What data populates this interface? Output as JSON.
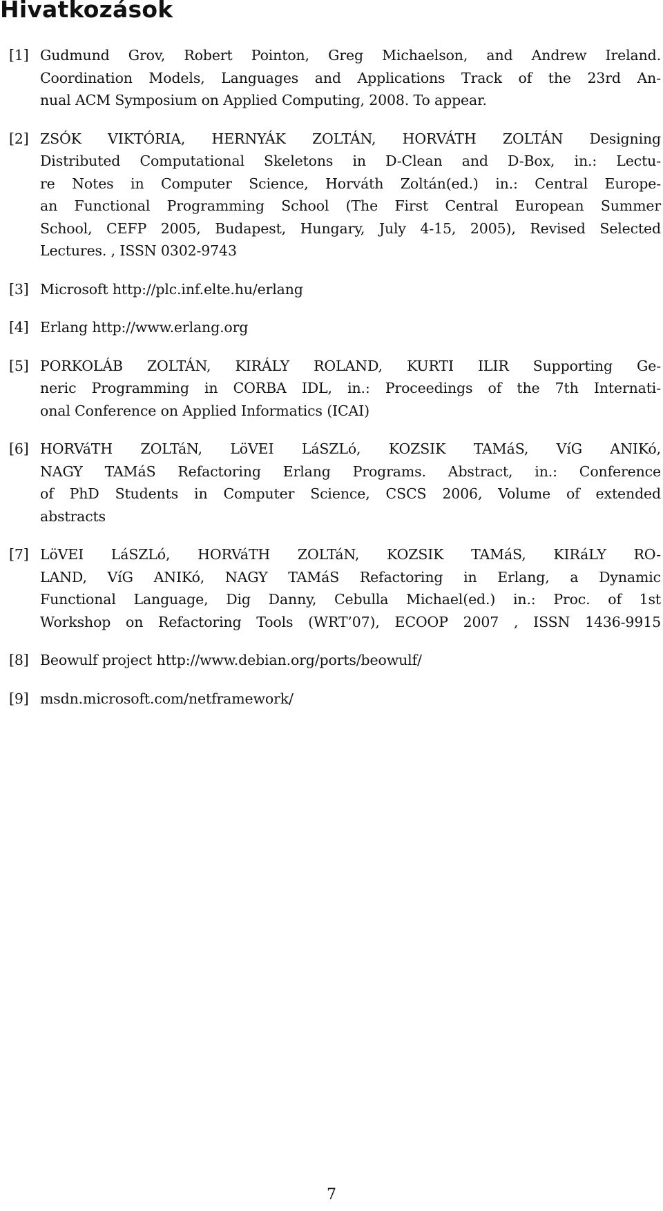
{
  "heading": "Hivatkozások",
  "references": [
    {
      "label": "[1]",
      "lines": [
        "Gudmund Grov, Robert Pointon, Greg Michaelson, and Andrew Ireland.",
        "Coordination Models, Languages and Applications Track of the 23rd An-",
        "nual ACM Symposium on Applied Computing, 2008. To appear."
      ]
    },
    {
      "label": "[2]",
      "lines": [
        "ZSÓK VIKTÓRIA, HERNYÁK ZOLTÁN, HORVÁTH ZOLTÁN Designing",
        "Distributed Computational Skeletons in D-Clean and D-Box, in.: Lectu-",
        "re Notes in Computer Science, Horváth Zoltán(ed.) in.: Central Europe-",
        "an Functional Programming School (The First Central European Summer",
        "School, CEFP 2005, Budapest, Hungary, July 4-15, 2005), Revised Selected",
        "Lectures. , ISSN 0302-9743"
      ]
    },
    {
      "label": "[3]",
      "lines": [
        "Microsoft http://plc.inf.elte.hu/erlang"
      ]
    },
    {
      "label": "[4]",
      "lines": [
        "Erlang http://www.erlang.org"
      ]
    },
    {
      "label": "[5]",
      "lines": [
        "PORKOLÁB ZOLTÁN, KIRÁLY ROLAND, KURTI ILIR Supporting Ge-",
        "neric Programming in CORBA IDL, in.: Proceedings of the 7th Internati-",
        "onal Conference on Applied Informatics (ICAI)"
      ]
    },
    {
      "label": "[6]",
      "lines": [
        "HORVáTH ZOLTáN, LöVEI LáSZLó, KOZSIK TAMáS, VíG ANIKó,",
        "NAGY TAMáS Refactoring Erlang Programs. Abstract, in.: Conference",
        "of PhD Students in Computer Science, CSCS 2006, Volume of extended",
        "abstracts"
      ]
    },
    {
      "label": "[7]",
      "lines": [
        "LöVEI LáSZLó, HORVáTH ZOLTáN, KOZSIK TAMáS, KIRáLY RO-",
        "LAND, VíG ANIKó, NAGY TAMáS Refactoring in Erlang, a Dynamic",
        "Functional Language, Dig Danny, Cebulla Michael(ed.) in.: Proc. of 1st",
        "Workshop on Refactoring Tools (WRT’07), ECOOP 2007 , ISSN 1436-9915"
      ]
    },
    {
      "label": "[8]",
      "lines": [
        "Beowulf project http://www.debian.org/ports/beowulf/"
      ]
    },
    {
      "label": "[9]",
      "lines": [
        "msdn.microsoft.com/netframework/"
      ]
    }
  ],
  "page_number": "7"
}
